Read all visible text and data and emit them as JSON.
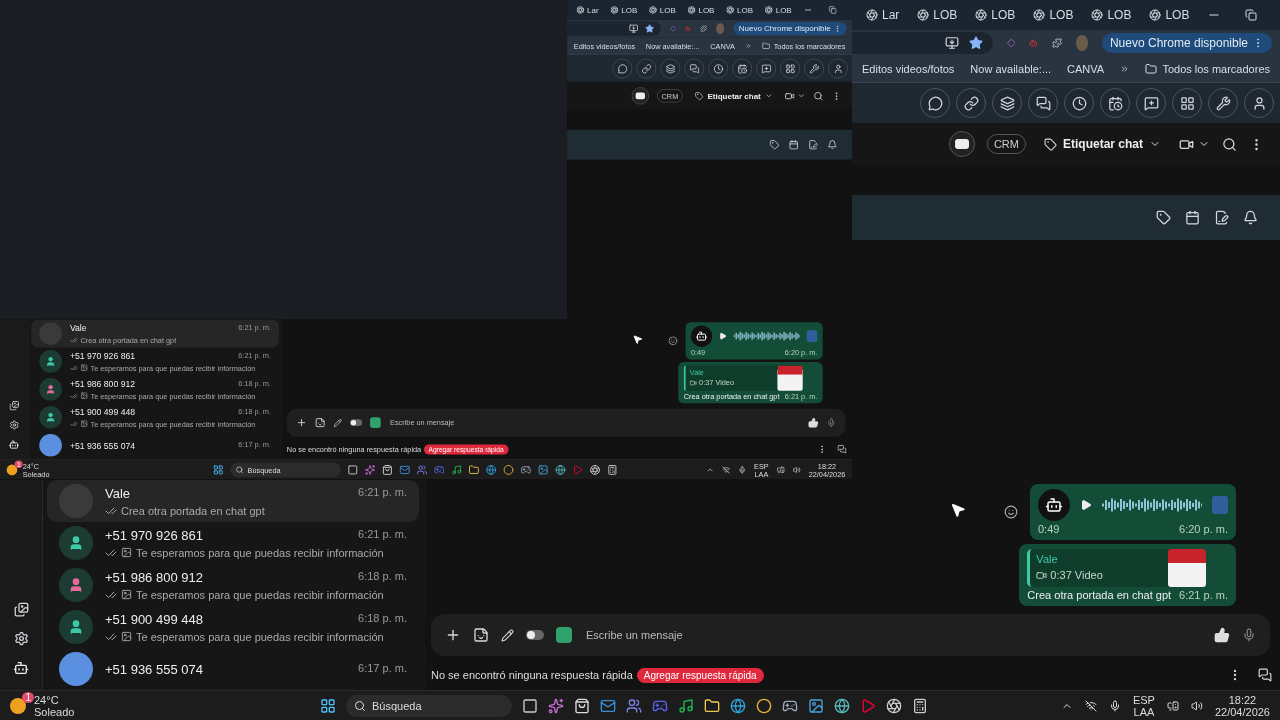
{
  "browser": {
    "tabs": [
      {
        "label": "Lar"
      },
      {
        "label": "LOB"
      },
      {
        "label": "LOB"
      },
      {
        "label": "LOB"
      },
      {
        "label": "LOB"
      },
      {
        "label": "LOB"
      }
    ],
    "update_button": "Nuevo Chrome disponible",
    "bookmarks": [
      "Editos videos/fotos",
      "Now available:...",
      "CANVA"
    ],
    "all_bookmarks": "Todos los marcadores"
  },
  "header": {
    "crm": "CRM",
    "label_chat": "Etiquetar chat"
  },
  "chats": [
    {
      "kind": "photo",
      "name": "Vale",
      "preview": "Crea otra portada en chat gpt",
      "time": "6:21 p. m.",
      "selected": true
    },
    {
      "kind": "contact",
      "name": "+51 970 926 861",
      "preview": "Te esperamos para que puedas recibir información",
      "time": "6:21 p. m.",
      "selected": false,
      "color": "#3ec9a7"
    },
    {
      "kind": "contact",
      "name": "+51 986 800 912",
      "preview": "Te esperamos para que puedas recibir información",
      "time": "6:18 p. m.",
      "selected": false,
      "color": "#e56a9c"
    },
    {
      "kind": "contact",
      "name": "+51 900 499 448",
      "preview": "Te esperamos para que puedas recibir información",
      "time": "6:18 p. m.",
      "selected": false,
      "color": "#3ec9a7"
    },
    {
      "kind": "contact",
      "name": "+51 936 555 074",
      "time": "6:17 p. m.",
      "selected": false,
      "color": "#5b8fe0"
    }
  ],
  "messages": [
    {
      "kind": "audio",
      "duration": "0:49",
      "time": "6:20 p. m."
    },
    {
      "kind": "reply",
      "quoted_author": "Vale",
      "quoted_text": "0:37 Video",
      "text": "Crea otra portada en chat gpt",
      "time": "6:21 p. m."
    }
  ],
  "composer": {
    "placeholder": "Escribe un mensaje",
    "toggle_on": false
  },
  "quick_replies": {
    "message": "No se encontró ninguna respuesta rápida",
    "button": "Agregar respuesta rápida"
  },
  "taskbar": {
    "temperature": "24°C",
    "weather": "Soleado",
    "weather_badge": "1",
    "search_placeholder": "Búsqueda",
    "language": "ESP",
    "layout": "LAA",
    "time": "18:22",
    "date": "22/04/2026"
  },
  "captured_screen": {
    "browser": {
      "tabs": [
        {
          "label": "Lar"
        },
        {
          "label": "LOB"
        },
        {
          "label": "LOB"
        },
        {
          "label": "LOB"
        },
        {
          "label": "LOB"
        },
        {
          "label": "LOB"
        }
      ],
      "update_button": "Nuevo Chrome disponible",
      "bookmarks": [
        "Editos videos/fotos",
        "Now available:...",
        "CANVA"
      ],
      "all_bookmarks": "Todos los marcadores"
    },
    "header": {
      "crm": "CRM",
      "label_chat": "Etiquetar chat"
    },
    "chats": [
      {
        "kind": "photo",
        "name": "Vale",
        "preview": "Crea otra portada en chat gpt",
        "time": "6:21 p. m.",
        "selected": true
      },
      {
        "kind": "contact",
        "name": "+51 970 926 861",
        "preview": "Te esperamos para que puedas recibir información",
        "time": "6:21 p. m.",
        "selected": false,
        "color": "#3ec9a7"
      },
      {
        "kind": "contact",
        "name": "+51 986 800 912",
        "preview": "Te esperamos para que puedas recibir información",
        "time": "6:18 p. m.",
        "selected": false,
        "color": "#e56a9c"
      },
      {
        "kind": "contact",
        "name": "+51 900 499 448",
        "preview": "Te esperamos para que puedas recibir información",
        "time": "6:18 p. m.",
        "selected": false,
        "color": "#3ec9a7"
      },
      {
        "kind": "contact",
        "name": "+51 936 555 074",
        "time": "6:17 p. m.",
        "selected": false,
        "color": "#5b8fe0"
      }
    ],
    "messages": [
      {
        "kind": "audio",
        "duration": "0:49",
        "time": "6:20 p. m."
      },
      {
        "kind": "reply",
        "quoted_author": "Vale",
        "quoted_text": "0:37 Video",
        "text": "Crea otra portada en chat gpt",
        "time": "6:21 p. m."
      }
    ],
    "composer": {
      "placeholder": "Escribe un mensaje",
      "toggle_on": false
    },
    "quick_replies": {
      "message": "No se encontró ninguna respuesta rápida",
      "button": "Agregar respuesta rápida"
    },
    "taskbar": {
      "temperature": "24°C",
      "weather": "Soleado",
      "weather_badge": "1",
      "search_placeholder": "Búsqueda",
      "language": "ESP",
      "layout": "LAA",
      "time": "18:22",
      "date": "22/04/2026"
    }
  }
}
